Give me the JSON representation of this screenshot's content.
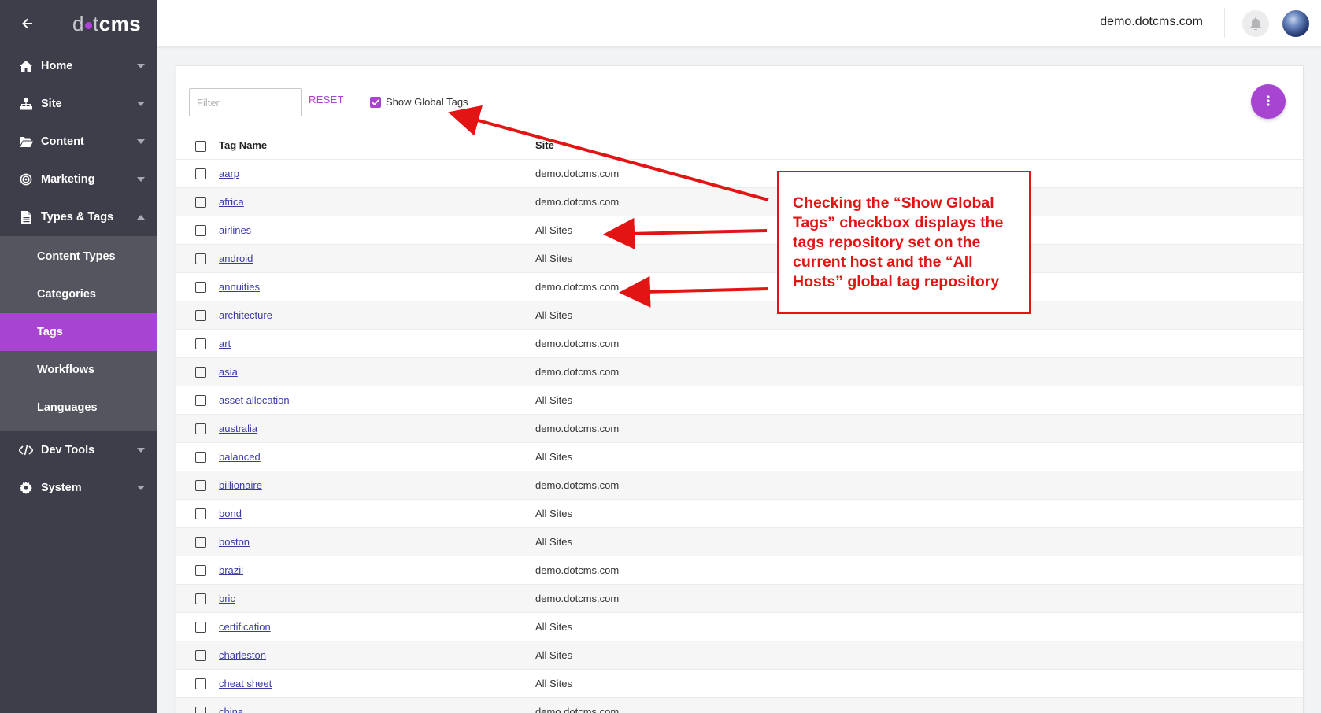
{
  "sidebar": {
    "logo": {
      "prefix": "d",
      "mid": "t",
      "brand": "cms"
    },
    "items": [
      {
        "label": "Home",
        "icon": "home-icon"
      },
      {
        "label": "Site",
        "icon": "sitemap-icon"
      },
      {
        "label": "Content",
        "icon": "folder-open-icon"
      },
      {
        "label": "Marketing",
        "icon": "target-icon"
      },
      {
        "label": "Types & Tags",
        "icon": "file-icon"
      },
      {
        "label": "Dev Tools",
        "icon": "code-icon"
      },
      {
        "label": "System",
        "icon": "gear-icon"
      }
    ],
    "subitems": [
      {
        "label": "Content Types"
      },
      {
        "label": "Categories"
      },
      {
        "label": "Tags"
      },
      {
        "label": "Workflows"
      },
      {
        "label": "Languages"
      }
    ],
    "active_subitem": "Tags"
  },
  "header": {
    "host": "demo.dotcms.com"
  },
  "toolbar": {
    "filter_placeholder": "Filter",
    "reset_label": "RESET",
    "show_global_label": "Show Global Tags",
    "show_global_checked": true
  },
  "table": {
    "columns": [
      "Tag Name",
      "Site"
    ],
    "rows": [
      {
        "name": "aarp",
        "site": "demo.dotcms.com"
      },
      {
        "name": "africa",
        "site": "demo.dotcms.com"
      },
      {
        "name": "airlines",
        "site": "All Sites"
      },
      {
        "name": "android",
        "site": "All Sites"
      },
      {
        "name": "annuities",
        "site": "demo.dotcms.com"
      },
      {
        "name": "architecture",
        "site": "All Sites"
      },
      {
        "name": "art",
        "site": "demo.dotcms.com"
      },
      {
        "name": "asia",
        "site": "demo.dotcms.com"
      },
      {
        "name": "asset allocation",
        "site": "All Sites"
      },
      {
        "name": "australia",
        "site": "demo.dotcms.com"
      },
      {
        "name": "balanced",
        "site": "All Sites"
      },
      {
        "name": "billionaire",
        "site": "demo.dotcms.com"
      },
      {
        "name": "bond",
        "site": "All Sites"
      },
      {
        "name": "boston",
        "site": "All Sites"
      },
      {
        "name": "brazil",
        "site": "demo.dotcms.com"
      },
      {
        "name": "bric",
        "site": "demo.dotcms.com"
      },
      {
        "name": "certification",
        "site": "All Sites"
      },
      {
        "name": "charleston",
        "site": "All Sites"
      },
      {
        "name": "cheat sheet",
        "site": "All Sites"
      },
      {
        "name": "china",
        "site": "demo.dotcms.com"
      }
    ]
  },
  "annotation": {
    "text": "Checking the “Show Global Tags” checkbox displays the tags repository set on the current host and the “All Hosts” global tag repository"
  },
  "colors": {
    "accent": "#a744d2",
    "sidebar_bg": "#3d3e4a",
    "annotation_red": "#e31414"
  }
}
